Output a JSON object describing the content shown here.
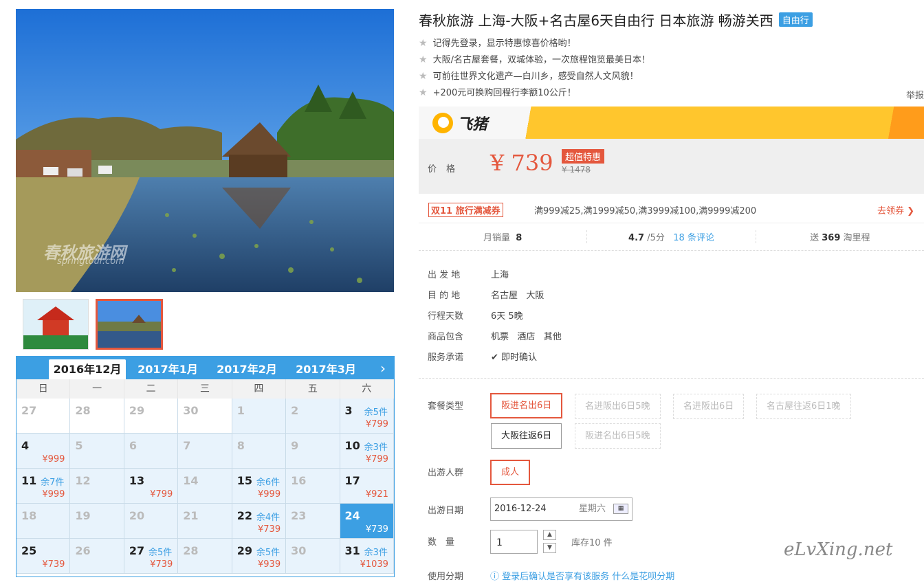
{
  "gallery": {
    "watermark_line1": "春秋旅游网",
    "watermark_line2": "springtour.com"
  },
  "calendar": {
    "months": [
      "2016年12月",
      "2017年1月",
      "2017年2月",
      "2017年3月"
    ],
    "active_month": 0,
    "next_icon": "chevron-right-icon",
    "weekdays": [
      "日",
      "一",
      "二",
      "三",
      "四",
      "五",
      "六"
    ],
    "rows": [
      [
        {
          "d": "27",
          "past": true
        },
        {
          "d": "28",
          "past": true
        },
        {
          "d": "29",
          "past": true
        },
        {
          "d": "30",
          "past": true
        },
        {
          "d": "1",
          "past": true,
          "av": true
        },
        {
          "d": "2",
          "past": true,
          "av": true
        },
        {
          "d": "3",
          "stock": "余5件",
          "price": "¥799",
          "av": true
        }
      ],
      [
        {
          "d": "4",
          "price": "¥999",
          "av": true
        },
        {
          "d": "5",
          "past": true,
          "av": true
        },
        {
          "d": "6",
          "past": true,
          "av": true
        },
        {
          "d": "7",
          "past": true,
          "av": true
        },
        {
          "d": "8",
          "past": true,
          "av": true
        },
        {
          "d": "9",
          "past": true,
          "av": true
        },
        {
          "d": "10",
          "stock": "余3件",
          "price": "¥799",
          "av": true
        }
      ],
      [
        {
          "d": "11",
          "stock": "余7件",
          "price": "¥999",
          "av": true
        },
        {
          "d": "12",
          "past": true,
          "av": true
        },
        {
          "d": "13",
          "price": "¥799",
          "av": true
        },
        {
          "d": "14",
          "past": true,
          "av": true
        },
        {
          "d": "15",
          "stock": "余6件",
          "price": "¥999",
          "av": true
        },
        {
          "d": "16",
          "past": true,
          "av": true
        },
        {
          "d": "17",
          "price": "¥921",
          "av": true
        }
      ],
      [
        {
          "d": "18",
          "past": true,
          "av": true
        },
        {
          "d": "19",
          "past": true,
          "av": true
        },
        {
          "d": "20",
          "past": true,
          "av": true
        },
        {
          "d": "21",
          "past": true,
          "av": true
        },
        {
          "d": "22",
          "stock": "余4件",
          "price": "¥739",
          "av": true
        },
        {
          "d": "23",
          "past": true,
          "av": true
        },
        {
          "d": "24",
          "price": "¥739",
          "sel": true
        }
      ],
      [
        {
          "d": "25",
          "price": "¥739",
          "av": true
        },
        {
          "d": "26",
          "past": true,
          "av": true
        },
        {
          "d": "27",
          "stock": "余5件",
          "price": "¥739",
          "av": true
        },
        {
          "d": "28",
          "past": true,
          "av": true
        },
        {
          "d": "29",
          "stock": "余5件",
          "price": "¥939",
          "av": true
        },
        {
          "d": "30",
          "past": true,
          "av": true
        },
        {
          "d": "31",
          "stock": "余3件",
          "price": "¥1039",
          "av": true
        }
      ]
    ]
  },
  "product": {
    "title": "春秋旅游 上海-大阪+名古屋6天自由行 日本旅游 畅游关西",
    "tag": "自由行",
    "features": [
      "记得先登录，显示特惠惊喜价格哟！",
      "大阪/名古屋套餐，双城体验，一次旅程饱览最美日本！",
      "可前往世界文化遗产—白川乡，感受自然人文风貌！",
      "+200元可换购回程行李额10公斤！"
    ],
    "report": "举报",
    "brand_name": "飞猪",
    "price_label": "价格",
    "price": "¥ 739",
    "hot_label": "超值特惠",
    "original_price": "¥ 1478",
    "coupon_badge": "双11 旅行满减券",
    "coupon_text": "满999减25,满1999减50,满3999减100,满9999减200",
    "coupon_link": "去领券 ❯",
    "sales_label": "月销量",
    "sales": "8",
    "rating": "4.7",
    "rating_suffix": "/5分",
    "reviews": "18 条评论",
    "miles_prefix": "送",
    "miles": "369",
    "miles_suffix": "淘里程"
  },
  "info": {
    "departure_label": "出 发 地",
    "departure": "上海",
    "destination_label": "目 的 地",
    "destination": "名古屋   大阪",
    "days_label": "行程天数",
    "days": "6天 5晚",
    "includes_label": "商品包含",
    "includes": "机票   酒店   其他",
    "promise_label": "服务承诺",
    "promise": "即时确认"
  },
  "options": {
    "package_label": "套餐类型",
    "packages": [
      "阪进名出6日",
      "名进阪出6日5晚",
      "名进阪出6日",
      "名古屋往返6日1晚",
      "大阪往返6日",
      "阪进名出6日5晚"
    ],
    "group_label": "出游人群",
    "group": "成人",
    "date_label": "出游日期",
    "date": "2016-12-24",
    "weekday": "星期六",
    "qty_label": "数　量",
    "qty": "1",
    "stock": "库存10 件",
    "installment_label": "使用分期",
    "installment_text": "登录后确认是否享有该服务 什么是花呗分期"
  },
  "signature": "eLvXing.net"
}
